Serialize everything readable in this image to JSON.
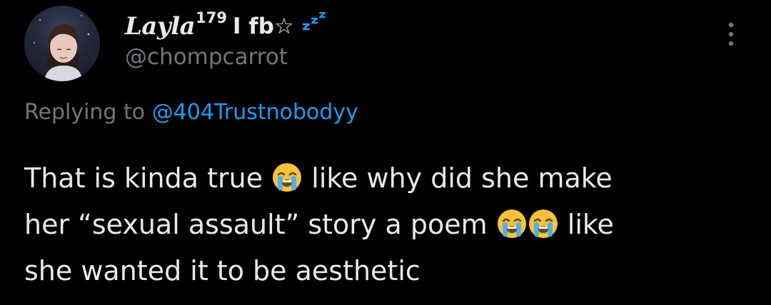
{
  "author": {
    "display_name_script": "Layla",
    "display_name_sup": "179",
    "display_name_rest": "I fb☆",
    "handle": "@chompcarrot"
  },
  "reply": {
    "prefix": "Replying to",
    "mention": "@404Trustnobodyy"
  },
  "tweet": {
    "line1_a": "That is kinda true ",
    "line1_b": " like why did she make",
    "line2_a": "her “sexual assault” story a poem ",
    "line2_b": " like",
    "line3": "she wanted it to be aesthetic"
  },
  "colors": {
    "background": "#000000",
    "primary_text": "#e7e9ea",
    "secondary_text": "#71767b",
    "link": "#1d9bf0",
    "zzz": "#1d9bf0",
    "emoji_face": "#f6c23d",
    "emoji_tears": "#4fb2ea"
  },
  "icons": {
    "status": "zzz-icon",
    "menu": "more-vertical-icon",
    "emoji": "loudly-crying-face-icon"
  }
}
